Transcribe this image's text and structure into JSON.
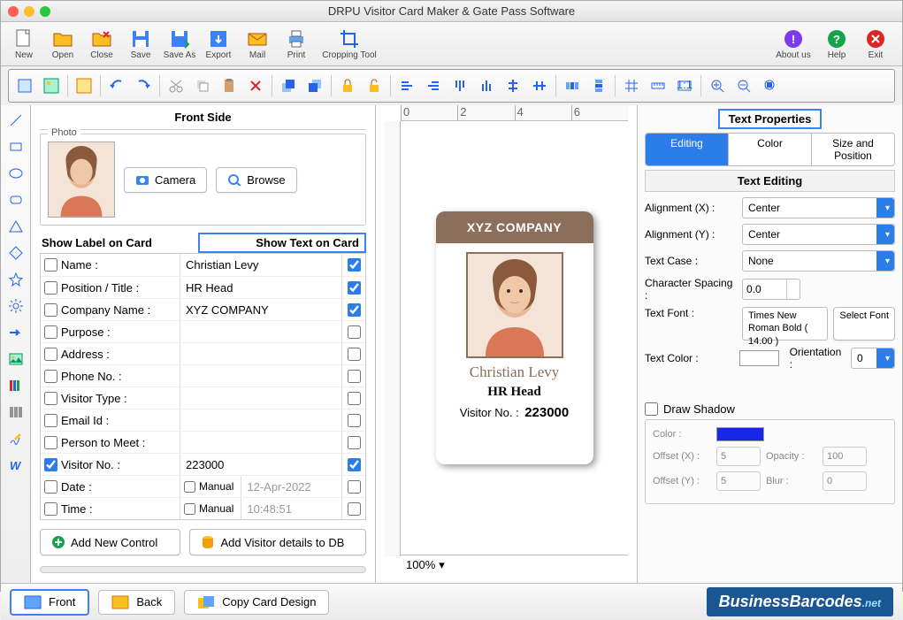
{
  "window": {
    "title": "DRPU Visitor Card Maker & Gate Pass Software"
  },
  "main_toolbar": {
    "new": "New",
    "open": "Open",
    "close": "Close",
    "save": "Save",
    "saveas": "Save As",
    "export": "Export",
    "mail": "Mail",
    "print": "Print",
    "crop": "Cropping Tool",
    "about": "About us",
    "help": "Help",
    "exit": "Exit"
  },
  "left_panel": {
    "title": "Front Side",
    "photo_legend": "Photo",
    "camera_btn": "Camera",
    "browse_btn": "Browse",
    "show_label_header": "Show Label on Card",
    "show_text_header": "Show Text on Card",
    "fields": [
      {
        "label": "Name :",
        "value": "Christian Levy",
        "label_chk": false,
        "text_chk": true
      },
      {
        "label": "Position / Title :",
        "value": "HR Head",
        "label_chk": false,
        "text_chk": true
      },
      {
        "label": "Company Name :",
        "value": "XYZ COMPANY",
        "label_chk": false,
        "text_chk": true
      },
      {
        "label": "Purpose :",
        "value": "",
        "label_chk": false,
        "text_chk": false
      },
      {
        "label": "Address :",
        "value": "",
        "label_chk": false,
        "text_chk": false
      },
      {
        "label": "Phone No. :",
        "value": "",
        "label_chk": false,
        "text_chk": false
      },
      {
        "label": "Visitor Type :",
        "value": "",
        "label_chk": false,
        "text_chk": false
      },
      {
        "label": "Email Id :",
        "value": "",
        "label_chk": false,
        "text_chk": false
      },
      {
        "label": "Person to Meet :",
        "value": "",
        "label_chk": false,
        "text_chk": false
      },
      {
        "label": "Visitor No. :",
        "value": "223000",
        "label_chk": true,
        "text_chk": true
      }
    ],
    "date_label": "Date :",
    "date_manual": "Manual",
    "date_value": "12-Apr-2022",
    "time_label": "Time :",
    "time_manual": "Manual",
    "time_value": "10:48:51",
    "add_control_btn": "Add New Control",
    "add_db_btn": "Add Visitor details to DB"
  },
  "card": {
    "company": "XYZ COMPANY",
    "name": "Christian Levy",
    "role": "HR Head",
    "visitor_label": "Visitor No. :",
    "visitor_no": "223000"
  },
  "canvas": {
    "zoom": "100%",
    "ruler": [
      "0",
      "2",
      "4",
      "6"
    ]
  },
  "right_panel": {
    "title": "Text Properties",
    "tabs": {
      "editing": "Editing",
      "color": "Color",
      "sizepos": "Size and Position"
    },
    "subtitle": "Text Editing",
    "align_x_label": "Alignment (X) :",
    "align_x": "Center",
    "align_y_label": "Alignment (Y) :",
    "align_y": "Center",
    "case_label": "Text Case :",
    "case": "None",
    "spacing_label": "Character Spacing :",
    "spacing": "0.0",
    "font_label": "Text Font :",
    "font": "Times New Roman Bold ( 14.00 )",
    "select_font": "Select Font",
    "color_label": "Text Color :",
    "orient_label": "Orientation :",
    "orient": "0",
    "shadow_chk": "Draw Shadow",
    "shadow": {
      "color_label": "Color :",
      "ox_label": "Offset (X) :",
      "ox": "5",
      "oy_label": "Offset (Y) :",
      "oy": "5",
      "opacity_label": "Opacity :",
      "opacity": "100",
      "blur_label": "Blur :",
      "blur": "0"
    }
  },
  "bottom": {
    "front": "Front",
    "back": "Back",
    "copy": "Copy Card Design",
    "brand": "BusinessBarcodes",
    "tld": ".net"
  }
}
